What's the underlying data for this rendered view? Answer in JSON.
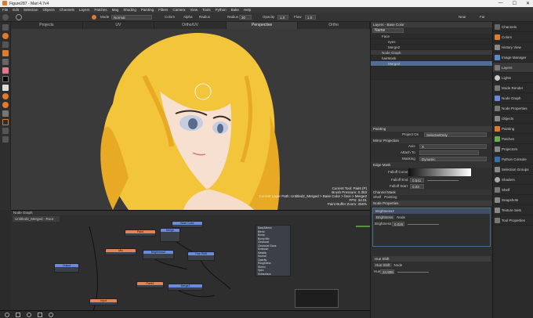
{
  "title": "Figure287 - Mari 4.7v4",
  "window_buttons": [
    "—",
    "☐",
    "✕"
  ],
  "menu": [
    "File",
    "Edit",
    "Selection",
    "Objects",
    "Channels",
    "Layers",
    "Patches",
    "Mag",
    "Shading",
    "Painting",
    "Filters",
    "Camera",
    "View",
    "Tools",
    "Python",
    "Bake",
    "Help"
  ],
  "toolbar": {
    "mode_label": "Mode",
    "mode_value": "Normal",
    "colors_label": "Colors",
    "alpha_label": "Alpha",
    "radius_label": "Radius",
    "radius_value": "30",
    "opacity_label": "Opacity",
    "opacity_value": "1.0",
    "flow_label": "Flow",
    "flow_value": "1.0",
    "near_label": "Near",
    "far_label": "Far"
  },
  "viewport": {
    "tabs": [
      "Projects",
      "UV",
      "Ortho/UV",
      "Perspective",
      "Ortho"
    ],
    "status_lines": [
      "Current Tool: Paint (P)",
      "Brush Pressure: 0.353",
      "Current Layer Path: Untitled2_Merged > Base Color > face > Merge2",
      "FPS: 34.01",
      "Paint Buffer Zoom: 256%"
    ]
  },
  "nodegraph": {
    "header": "Node Graph",
    "tab": "Untitled2_Merged - Root",
    "nodes": [
      {
        "label": "Paint",
        "color": "#e0855a"
      },
      {
        "label": "Merge",
        "color": "#6a8ae0"
      },
      {
        "label": "Base Color",
        "color": "#6a8ae0"
      },
      {
        "label": "Mix",
        "color": "#e0855a"
      },
      {
        "label": "Brightness2",
        "color": "#6a8ae0"
      },
      {
        "label": "Hue Shift",
        "color": "#6a8ae0"
      },
      {
        "label": "Paint2",
        "color": "#e0855a"
      },
      {
        "label": "Merge2",
        "color": "#6a8ae0"
      },
      {
        "label": "Output",
        "color": "#6a8ae0"
      },
      {
        "label": "Input",
        "color": "#e0855a"
      }
    ],
    "port_list": [
      "BaseAlbedo",
      "Blend",
      "Bump",
      "Bump Mix",
      "Clearcoat",
      "Clearcoat Gloss",
      "Emission",
      "Metallic",
      "Normal",
      "Opacity",
      "Roughness",
      "Sheen",
      "Spec",
      "Subsurface"
    ]
  },
  "layers": {
    "header": "Layers - Base Color",
    "filter_value": "Name",
    "rows": [
      "Face",
      "eyes",
      "Merge2",
      "Node Graph",
      "hairMask",
      "Merge2"
    ]
  },
  "painting": {
    "header": "Painting",
    "project_on_label": "Project On",
    "project_on_value": "SelectedOnly",
    "mirror_header": "Mirror Projection",
    "axis_label": "Axis",
    "axis_value": "X",
    "attach_label": "Attach To",
    "masking_label": "Masking",
    "masking_value": "Dynamic",
    "edge_header": "Edge Mask",
    "falloff_curve_label": "Falloff Curve",
    "falloff_end_label": "Falloff End",
    "falloff_end_value": "0.541",
    "falloff_start_label": "Falloff Start",
    "falloff_start_value": "0.03",
    "channel_mask_header": "Channel Mask",
    "bottom_tabs": [
      "Shelf",
      "Painting"
    ]
  },
  "node_properties": {
    "header": "Node Properties",
    "node1_title": "Brightness2",
    "node1_tabs": [
      "Brightness",
      "Node"
    ],
    "brightness_label": "Brightness",
    "brightness_value": "0.026",
    "node2_title": "Hue Shift",
    "node2_tabs": [
      "Hue Shift",
      "Node"
    ],
    "hue_label": "Hue",
    "hue_value": "24.806"
  },
  "sidebar": [
    "Channels",
    "Colors",
    "History View",
    "Image Manager",
    "Layers",
    "Lights",
    "Mode Render",
    "Node Graph",
    "Node Properties",
    "Objects",
    "Painting",
    "Patches",
    "Projectors",
    "Python Console",
    "Selection Groups",
    "Shaders",
    "Shelf",
    "Snapshots",
    "Texture Sets",
    "Tool Properties"
  ],
  "colors": {
    "accent": "#e07a2c",
    "hair": "#f2c53a",
    "layer_select": "#4f6d96"
  }
}
